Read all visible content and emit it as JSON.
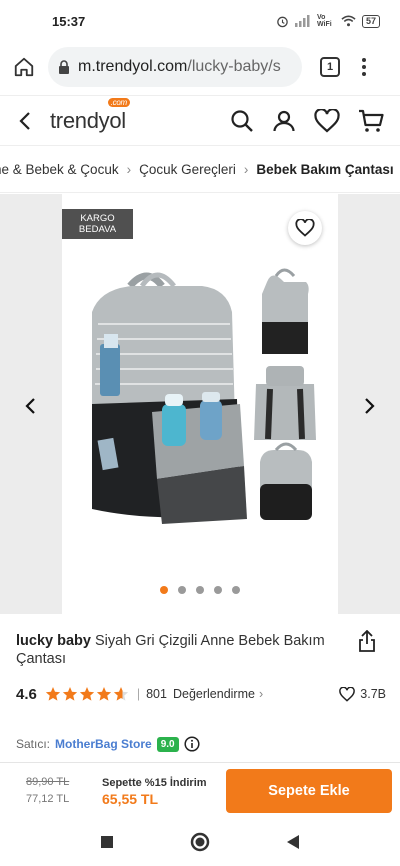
{
  "status_bar": {
    "time": "15:37",
    "volte": "Vo WiFi",
    "battery": "57"
  },
  "browser": {
    "domain": "m.trendyol.com",
    "path": "/lucky-baby/s",
    "tab_count": "1"
  },
  "header": {
    "logo": "trendyol",
    "logo_badge": ".com"
  },
  "breadcrumb": {
    "items": [
      "ne & Bebek & Çocuk",
      "Çocuk Gereçleri",
      "Bebek Bakım Çantası"
    ]
  },
  "gallery": {
    "badge_line1": "KARGO",
    "badge_line2": "BEDAVA",
    "slide_count": 5,
    "active_slide": 0
  },
  "product": {
    "brand": "lucky baby",
    "name": "Siyah Gri Çizgili Anne Bebek Bakım Çantası",
    "rating": "4.6",
    "stars_value": 4.6,
    "review_count": "801",
    "review_label": "Değerlendirme",
    "favorite_count": "3.7B"
  },
  "seller": {
    "label": "Satıcı:",
    "name": "MotherBag Store",
    "score": "9.0"
  },
  "purchase": {
    "original_price": "89,90 TL",
    "sale_price": "77,12 TL",
    "discount_label": "Sepette %15 İndirim",
    "final_price": "65,55 TL",
    "add_to_cart": "Sepete Ekle"
  },
  "colors": {
    "brand_orange": "#f27a1a",
    "seller_blue": "#4a7dd0",
    "score_green": "#2bb24c"
  }
}
